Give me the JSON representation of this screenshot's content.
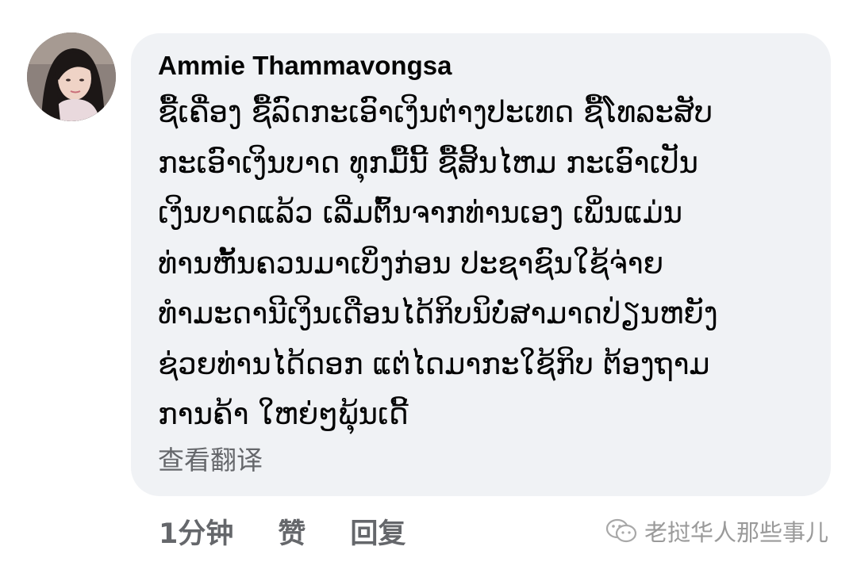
{
  "comment": {
    "author": "Ammie Thammavongsa",
    "lines": [
      "ຊື້ເຄື່ອງ ຊື້ລົດກະເອົາເງິນຕ່າງປະເທດ ຊື້ໂທລະສັບ",
      "ກະເອົາເງິນບາດ ທຸກມື້ນີ້ ຊື້ສິ້ນໄຫມ ກະເອົາເປັນ",
      "ເງິນບາດແລ້ວ ເລີ່ມຕົ້ນຈາກທ່ານເອງ ເພິ່ນແມ່ນ",
      "ທ່ານຫັ້ນຄວນມາເບິ່ງກ່ອນ ປະຊາຊົນໃຊ້ຈ່າຍ",
      "ທຳມະດານີເງິນເດືອນໄດ້ກິບນິບໍ່ສາມາດປ່ຽນຫຍັງ",
      "ຊ່ວຍທ່ານໄດ້ດອກ ແຕ່ໄດມາກະໃຊ້ກິບ ຕ້ອງຖາມ",
      "ການຄ້າ ໃຫຍ່ໆພຸ້ນເດີ້"
    ],
    "translate_label": "查看翻译"
  },
  "actions": {
    "time": "1分钟",
    "like": "赞",
    "reply": "回复"
  },
  "watermark": {
    "icon": "wechat-official-account-icon",
    "text": "老挝华人那些事儿"
  },
  "colors": {
    "bubble": "#f0f2f5",
    "text": "#050505",
    "secondary": "#65676b"
  }
}
